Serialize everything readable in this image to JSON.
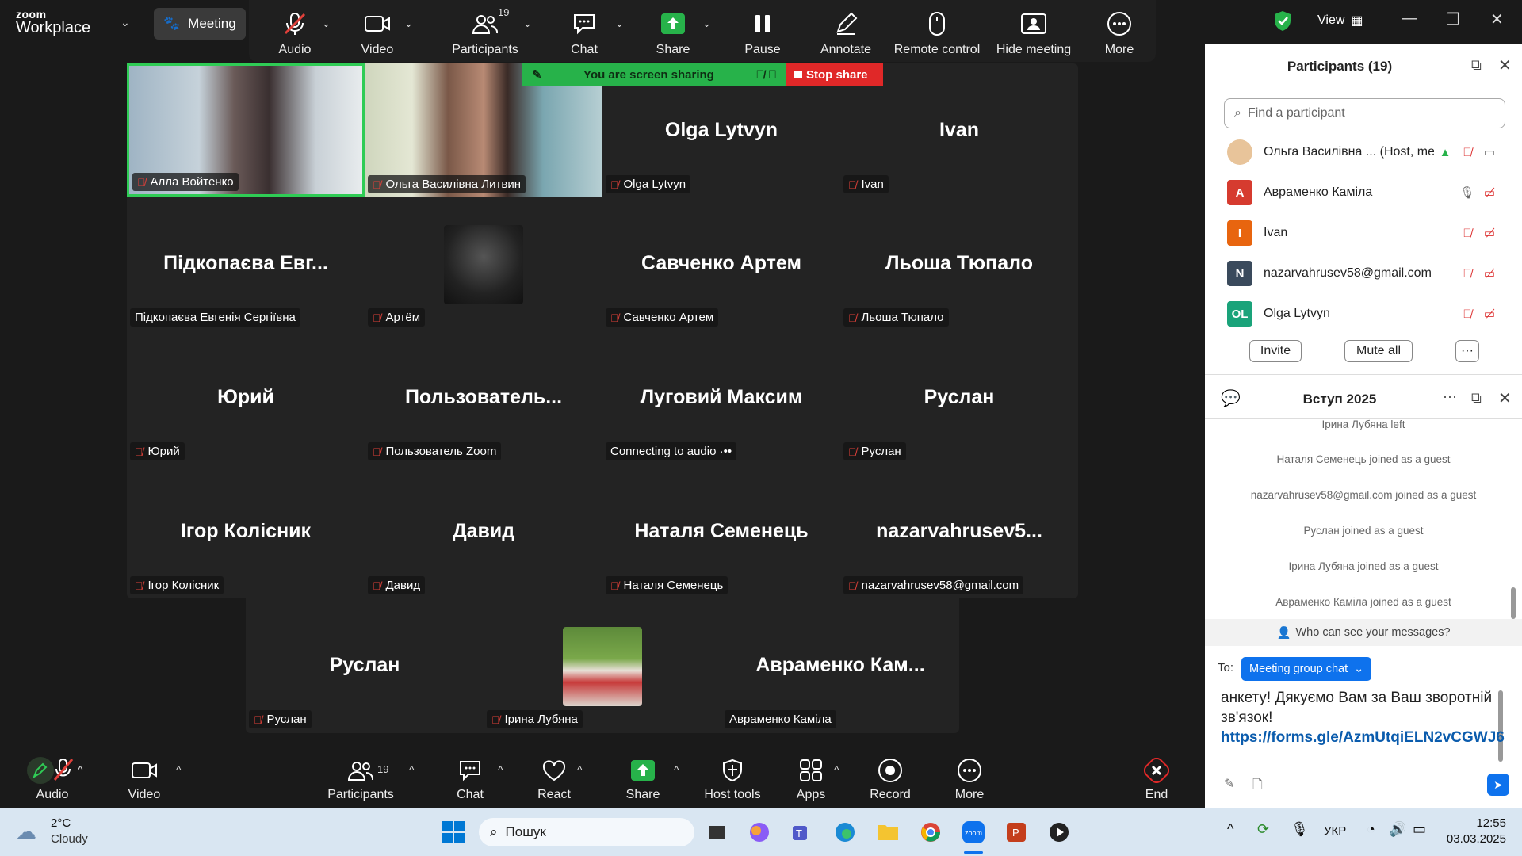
{
  "app": {
    "logo_top": "zoom",
    "logo_bottom": "Workplace",
    "meeting_label": "Meeting",
    "view_label": "View"
  },
  "toolbar_top": {
    "audio": "Audio",
    "video": "Video",
    "participants": "Participants",
    "participants_count": "19",
    "chat": "Chat",
    "share": "Share",
    "pause": "Pause",
    "annotate": "Annotate",
    "remote_control": "Remote control",
    "hide_meeting": "Hide meeting",
    "more": "More"
  },
  "share_banner": {
    "status": "You are screen sharing",
    "stop": "Stop share"
  },
  "tiles": [
    {
      "name": "",
      "label": "Алла Войтенко",
      "muted": true
    },
    {
      "name": "",
      "label": "Ольга Василівна Литвин",
      "muted": true
    },
    {
      "name": "Olga Lytvyn",
      "label": "Olga Lytvyn",
      "muted": true
    },
    {
      "name": "Ivan",
      "label": "Ivan",
      "muted": true
    },
    {
      "name": "Підкопаєва Евг...",
      "label": "Підкопаєва Евгенія Сергіївна",
      "muted": false
    },
    {
      "name": "",
      "label": "Артём",
      "muted": true
    },
    {
      "name": "Савченко Артем",
      "label": "Савченко Артем",
      "muted": true
    },
    {
      "name": "Льоша Тюпало",
      "label": "Льоша Тюпало",
      "muted": true
    },
    {
      "name": "Юрий",
      "label": "Юрий",
      "muted": true
    },
    {
      "name": "Пользователь...",
      "label": "Пользователь Zoom",
      "muted": true
    },
    {
      "name": "Луговий Максим",
      "label": "Connecting to audio ·••",
      "muted": false
    },
    {
      "name": "Руслан",
      "label": "Руслан",
      "muted": true
    },
    {
      "name": "Ігор Колісник",
      "label": "Ігор Колісник",
      "muted": true
    },
    {
      "name": "Давид",
      "label": "Давид",
      "muted": true
    },
    {
      "name": "Наталя Семенець",
      "label": "Наталя Семенець",
      "muted": true
    },
    {
      "name": "nazarvahrusev5...",
      "label": "nazarvahrusev58@gmail.com",
      "muted": true
    },
    {
      "name": "Руслан",
      "label": "Руслан",
      "muted": true
    },
    {
      "name": "",
      "label": "Ірина Лубяна",
      "muted": true
    },
    {
      "name": "Авраменко Кам...",
      "label": "Авраменко Каміла",
      "muted": false
    }
  ],
  "toolbar_bottom": {
    "audio": "Audio",
    "video": "Video",
    "participants": "Participants",
    "participants_count": "19",
    "chat": "Chat",
    "react": "React",
    "share": "Share",
    "host_tools": "Host tools",
    "apps": "Apps",
    "record": "Record",
    "more": "More",
    "end": "End"
  },
  "participants_panel": {
    "title": "Participants (19)",
    "search_placeholder": "Find a participant",
    "list": [
      {
        "name": "Ольга Василівна ... (Host, me)",
        "initials": "",
        "color": "#f0c090"
      },
      {
        "name": "Авраменко Каміла",
        "initials": "А",
        "color": "#d63b2f"
      },
      {
        "name": "Ivan",
        "initials": "I",
        "color": "#e8650f"
      },
      {
        "name": "nazarvahrusev58@gmail.com",
        "initials": "N",
        "color": "#3a4a5c"
      },
      {
        "name": "Olga Lytvyn",
        "initials": "OL",
        "color": "#1aa37a"
      }
    ],
    "invite": "Invite",
    "mute_all": "Mute all"
  },
  "chat_panel": {
    "title": "Вступ 2025",
    "messages": [
      "Ірина Лубяна left",
      "Наталя Семенець joined as a guest",
      "nazarvahrusev58@gmail.com joined as a guest",
      "Руслан joined as a guest",
      "Ірина Лубяна joined as a guest",
      "Авраменко Каміла joined as a guest"
    ],
    "who_can_see": "Who can see your messages?",
    "to_label": "To:",
    "to_value": "Meeting group chat",
    "draft_text": "анкету! Дякуємо Вам за Ваш зворотній зв'язок!",
    "draft_link": "https://forms.gle/AzmUtqiELN2vCGWJ6"
  },
  "taskbar": {
    "weather_temp": "2°C",
    "weather_desc": "Cloudy",
    "search": "Пошук",
    "lang": "УКР",
    "time": "12:55",
    "date": "03.03.2025"
  },
  "colors": {
    "accent": "#0e72ed",
    "share_green": "#27b24a",
    "stop_red": "#e02828"
  }
}
